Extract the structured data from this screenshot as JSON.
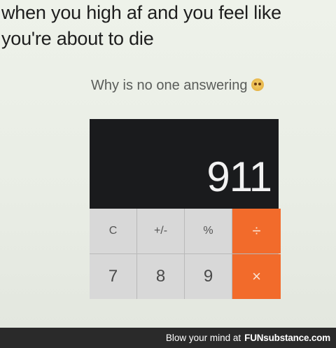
{
  "caption": {
    "line1": "when you high af and you feel like",
    "line2": "you're about to die"
  },
  "subcaption": "Why is no one answering",
  "emoji": "scared-face-icon",
  "calculator": {
    "display_value": "911",
    "row1": [
      "C",
      "+/-",
      "%",
      "÷"
    ],
    "row2": [
      "7",
      "8",
      "9",
      "×"
    ],
    "accent_color": "#f26b2b"
  },
  "footer": {
    "text": "Blow your mind at",
    "brand": "FUNsubstance.com"
  }
}
